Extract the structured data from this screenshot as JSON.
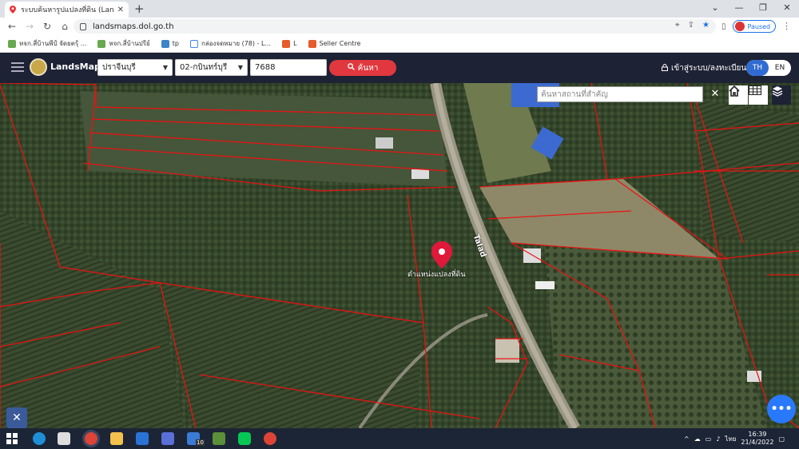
{
  "browser": {
    "tab_title": "ระบบค้นหารูปแปลงที่ดิน (LandsMaps)",
    "tab_close": "✕",
    "new_tab": "+",
    "url": "landsmaps.dol.go.th",
    "profile_status": "Paused",
    "window_controls": [
      "⌄",
      "—",
      "❐",
      "✕"
    ]
  },
  "bookmarks": [
    {
      "label": "หจก.สี่บ้านพีป์ จัดยตรุ้ ...",
      "color": "#6aa84f"
    },
    {
      "label": "หจก.สี่บ้านปรีย์",
      "color": "#6aa84f"
    },
    {
      "label": "tp",
      "color": "#3d85c6"
    },
    {
      "label": "กล่องจดหมาย (78) - L...",
      "color": "#4285f4"
    },
    {
      "label": "L",
      "color": "#e65c2a"
    },
    {
      "label": "Seller Centre",
      "color": "#e65c2a"
    }
  ],
  "app": {
    "brand": "LandsMaps",
    "province": "ปราจีนบุรี",
    "district": "02-กบินทร์บุรี",
    "parcel_number": "7688",
    "search_button": "ค้นหา",
    "login": "เข้าสู่ระบบ/ลงทะเบียน",
    "lang_th": "TH",
    "lang_en": "EN"
  },
  "map": {
    "place_search_placeholder": "ค้นหาสถานที่สำคัญ",
    "close": "✕",
    "marker_label": "ตำแหน่งแปลงที่ดิน",
    "road_label": "Talad",
    "fab_label": "•••"
  },
  "taskbar": {
    "language": "ไทย",
    "time": "16:39",
    "date": "21/4/2022",
    "notification_count": "10"
  }
}
